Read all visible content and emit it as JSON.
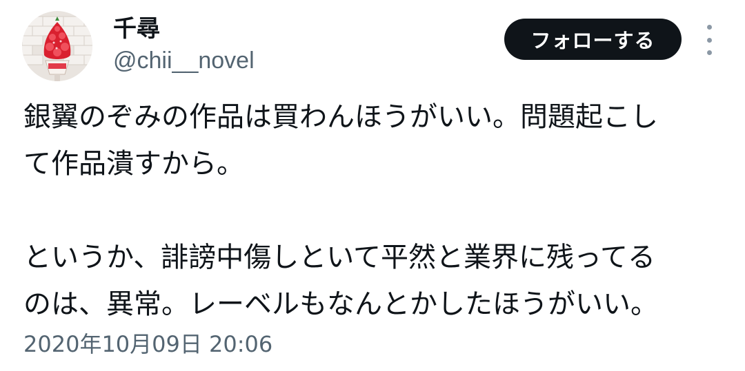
{
  "user": {
    "display_name": "千尋",
    "handle": "@chii__novel",
    "avatar_icon": "avatar-strawberry-parfait"
  },
  "actions": {
    "follow_label": "フォローする",
    "more_icon": "more-vertical-icon"
  },
  "tweet": {
    "lines": [
      "銀翼のぞみの作品は買わんほうがいい。問題起こし",
      "て作品潰すから。",
      "というか、誹謗中傷しといて平然と業界に残ってる",
      "のは、異常。レーベルもなんとかしたほうがいい。"
    ],
    "timestamp": "2020年10月09日 20:06"
  },
  "colors": {
    "text": "#0f1419",
    "secondary": "#536471",
    "button_bg": "#0f1419",
    "button_text": "#ffffff"
  }
}
